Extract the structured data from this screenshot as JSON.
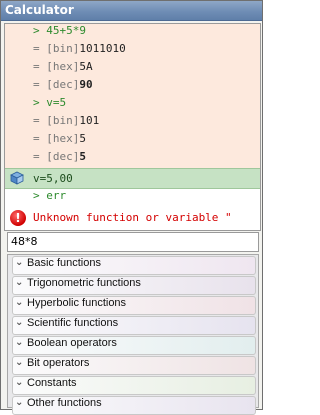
{
  "window": {
    "title": "Calculator"
  },
  "history": {
    "entries": [
      {
        "kind": "input",
        "text": "> 45+5*9"
      },
      {
        "kind": "result",
        "prefix": "= [bin]",
        "value": "1011010",
        "bold": false
      },
      {
        "kind": "result",
        "prefix": "= [hex]",
        "value": "5A",
        "bold": false
      },
      {
        "kind": "result",
        "prefix": "= [dec]",
        "value": "90",
        "bold": true
      },
      {
        "kind": "input",
        "text": "> v=5"
      },
      {
        "kind": "result",
        "prefix": "= [bin]",
        "value": "101",
        "bold": false
      },
      {
        "kind": "result",
        "prefix": "= [hex]",
        "value": "5",
        "bold": false
      },
      {
        "kind": "result",
        "prefix": "= [dec]",
        "value": "5",
        "bold": true
      },
      {
        "kind": "assign",
        "text": "v=5,00",
        "icon": "variable-icon"
      },
      {
        "kind": "input2",
        "text": "> err"
      },
      {
        "kind": "error",
        "text": "Unknown function or variable \"",
        "icon": "error-icon"
      }
    ]
  },
  "expression_input": {
    "value": "48*8"
  },
  "sections": [
    {
      "label": "Basic functions",
      "color": "#efe6f0"
    },
    {
      "label": "Trigonometric functions",
      "color": "#e8e2ec"
    },
    {
      "label": "Hyperbolic functions",
      "color": "#f0e2e6"
    },
    {
      "label": "Scientific functions",
      "color": "#e6e3ef"
    },
    {
      "label": "Boolean operators",
      "color": "#e2eeee"
    },
    {
      "label": "Bit operators",
      "color": "#efe3e4"
    },
    {
      "label": "Constants",
      "color": "#e7efe2"
    },
    {
      "label": "Other functions",
      "color": "#e8e4ef"
    }
  ],
  "colors": {
    "title_bar": "#6f8db5",
    "input_text": "#2e8b2e",
    "error_text": "#d40000",
    "assign_bg": "#c6e2c4",
    "result_bg": "#fde9dd"
  }
}
